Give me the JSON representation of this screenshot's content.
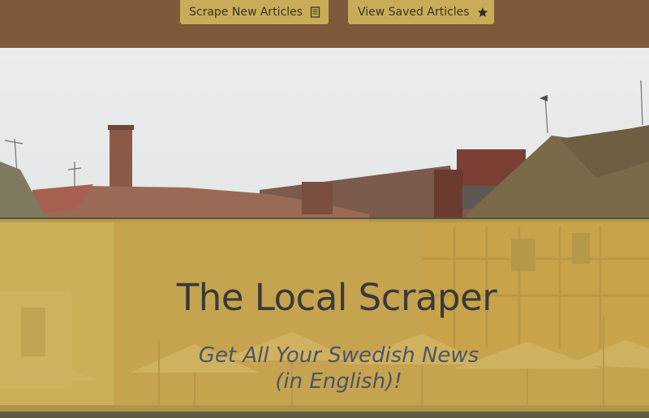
{
  "nav": {
    "scrape_label": "Scrape New Articles",
    "scrape_icon": "newspaper-icon",
    "saved_label": "View Saved Articles",
    "saved_icon": "star-icon"
  },
  "hero": {
    "title": "The Local Scraper",
    "subtitle_line1": "Get All Your Swedish News",
    "subtitle_line2": "(in English)!"
  },
  "colors": {
    "navbar": "#7f5a3a",
    "button": "#c9ac58",
    "overlay": "#c9a546"
  }
}
